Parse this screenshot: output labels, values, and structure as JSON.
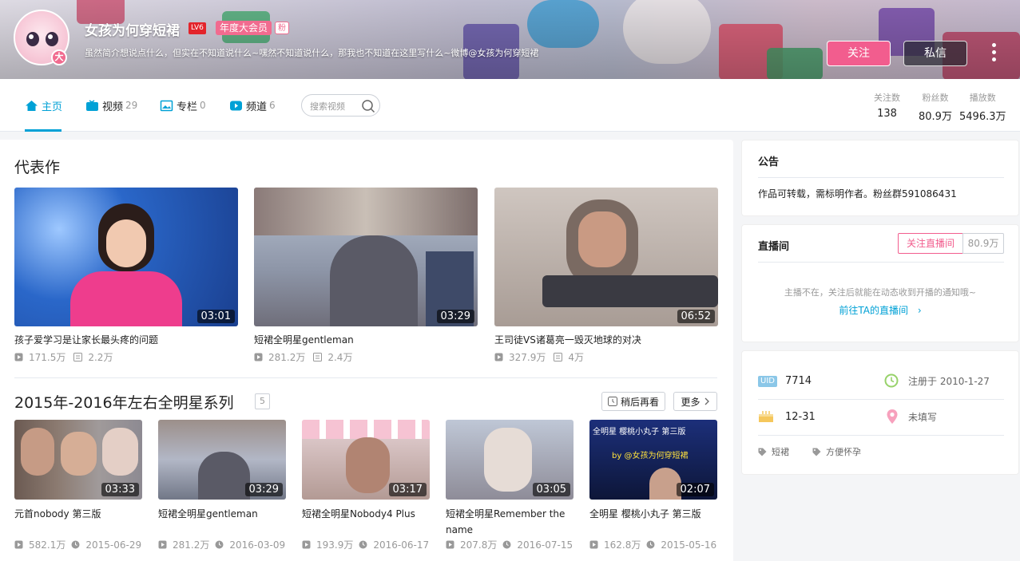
{
  "profile": {
    "name": "女孩为何穿短裙",
    "level": "LV6",
    "vip": "年度大会员",
    "fan_badge": "粉",
    "avatar_badge": "大",
    "sign": "虽然简介想说点什么，但实在不知道说什么~嘿然不知道说什么，那我也不知道在这里写什么~微博@女孩为何穿短裙",
    "follow_label": "关注",
    "message_label": "私信"
  },
  "nav": {
    "tabs": [
      {
        "label": "主页",
        "count": ""
      },
      {
        "label": "视频",
        "count": "29"
      },
      {
        "label": "专栏",
        "count": "0"
      },
      {
        "label": "频道",
        "count": "6"
      }
    ],
    "search_placeholder": "搜索视频",
    "stats": [
      {
        "label": "关注数",
        "value": "138"
      },
      {
        "label": "粉丝数",
        "value": "80.9万"
      },
      {
        "label": "播放数",
        "value": "5496.3万"
      }
    ]
  },
  "representative": {
    "title": "代表作",
    "videos": [
      {
        "title": "孩子爱学习是让家长最头疼的问题",
        "duration": "03:01",
        "plays": "171.5万",
        "danmaku": "2.2万"
      },
      {
        "title": "短裙全明星gentleman",
        "duration": "03:29",
        "plays": "281.2万",
        "danmaku": "2.4万"
      },
      {
        "title": "王司徒VS诸葛亮一毁灭地球的对决",
        "duration": "06:52",
        "plays": "327.9万",
        "danmaku": "4万"
      }
    ]
  },
  "series": {
    "title": "2015年-2016年左右全明星系列",
    "count": "5",
    "watch_later": "稍后再看",
    "more": "更多",
    "videos": [
      {
        "title": "元首nobody 第三版",
        "duration": "03:33",
        "plays": "582.1万",
        "date": "2015-06-29"
      },
      {
        "title": "短裙全明星gentleman",
        "duration": "03:29",
        "plays": "281.2万",
        "date": "2016-03-09"
      },
      {
        "title": "短裙全明星Nobody4 Plus",
        "duration": "03:17",
        "plays": "193.9万",
        "date": "2016-06-17"
      },
      {
        "title": "短裙全明星Remember the name",
        "duration": "03:05",
        "plays": "207.8万",
        "date": "2016-07-15"
      },
      {
        "title": "全明星 樱桃小丸子 第三版",
        "duration": "02:07",
        "plays": "162.8万",
        "date": "2015-05-16"
      }
    ],
    "thumb5_overlay": [
      "全明星 樱桃小丸子 第三版",
      "by @女孩为何穿短裙"
    ]
  },
  "notice": {
    "title": "公告",
    "text": "作品可转载，需标明作者。粉丝群591086431"
  },
  "live": {
    "title": "直播间",
    "follow_label": "关注直播间",
    "fans": "80.9万",
    "tip": "主播不在，关注后就能在动态收到开播的通知哦~",
    "link": "前往TA的直播间"
  },
  "info": {
    "uid_badge": "UID",
    "uid": "7714",
    "register": "注册于 2010-1-27",
    "birthday": "12-31",
    "location": "未填写",
    "tags": [
      "短裙",
      "方便怀孕"
    ]
  },
  "colors": {
    "accent": "#00a1d6",
    "pink": "#f25d8e",
    "text": "#222222",
    "muted": "#999999"
  }
}
